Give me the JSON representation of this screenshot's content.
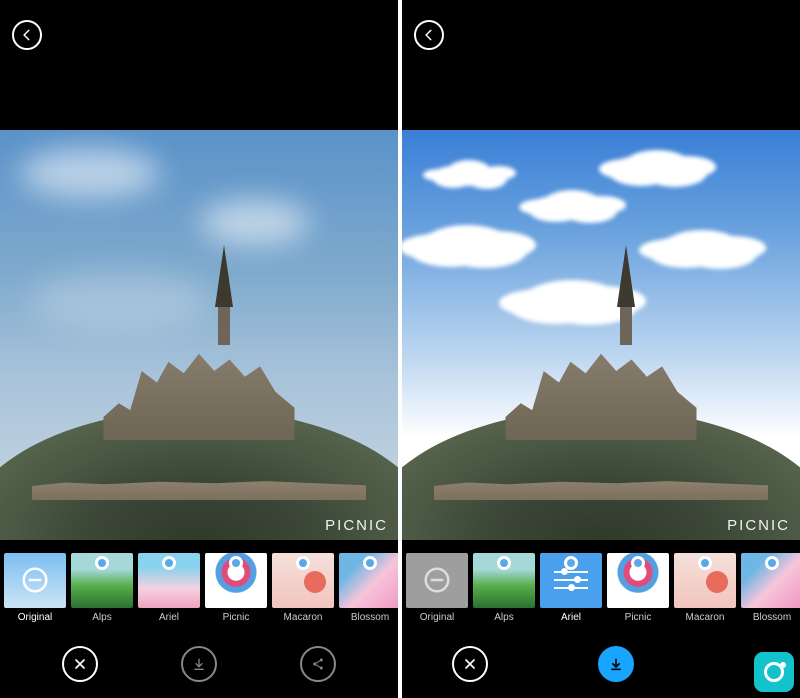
{
  "watermark": "PICNIC",
  "left": {
    "selected_filter_index": 0,
    "filters": [
      {
        "label": "Original"
      },
      {
        "label": "Alps"
      },
      {
        "label": "Ariel"
      },
      {
        "label": "Picnic"
      },
      {
        "label": "Macaron"
      },
      {
        "label": "Blossom"
      }
    ]
  },
  "right": {
    "selected_filter_index": 2,
    "filters": [
      {
        "label": "Original"
      },
      {
        "label": "Alps"
      },
      {
        "label": "Ariel"
      },
      {
        "label": "Picnic"
      },
      {
        "label": "Macaron"
      },
      {
        "label": "Blossom"
      }
    ]
  }
}
